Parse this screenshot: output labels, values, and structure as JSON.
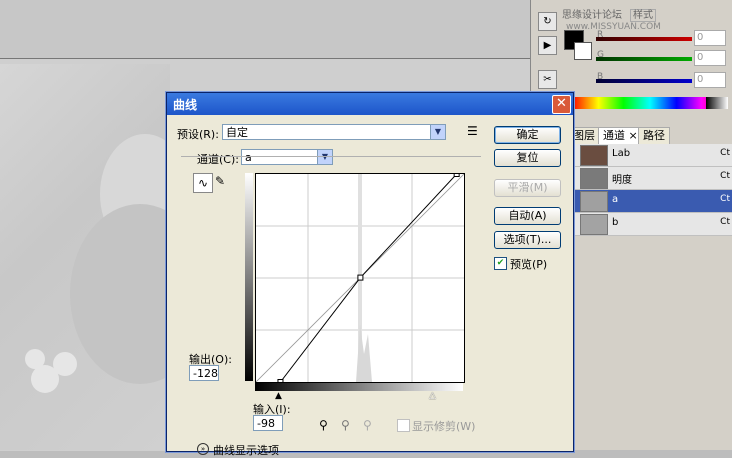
{
  "background": {
    "top_tab_text": "思缘设计论坛",
    "top_tab_text2": "样式",
    "site": "www.MISSYUAN.COM"
  },
  "color_panel": {
    "channels": [
      {
        "label": "R",
        "value": "0",
        "color": "#cc0000"
      },
      {
        "label": "G",
        "value": "0",
        "color": "#00aa00"
      },
      {
        "label": "B",
        "value": "0",
        "color": "#0000cc"
      }
    ]
  },
  "channels_panel": {
    "tabs": [
      "图层",
      "通道",
      "路径"
    ],
    "rows": [
      {
        "name": "Lab",
        "key": "Ct"
      },
      {
        "name": "明度",
        "key": "Ct"
      },
      {
        "name": "a",
        "key": "Ct"
      },
      {
        "name": "b",
        "key": "Ct"
      }
    ]
  },
  "dialog": {
    "title": "曲线",
    "close": "✕",
    "preset_label": "预设(R):",
    "preset_value": "自定",
    "channel_label": "通道(C):",
    "channel_value": "a",
    "buttons": {
      "ok": "确定",
      "reset": "复位",
      "smooth": "平滑(M)",
      "auto": "自动(A)",
      "options": "选项(T)..."
    },
    "preview_label": "预览(P)",
    "output_label": "输出(O):",
    "output_value": "-128",
    "input_label": "输入(I):",
    "input_value": "-98",
    "show_clipping": "显示修剪(W)",
    "curve_options": "曲线显示选项"
  },
  "curve": {
    "points": [
      [
        -98,
        -128
      ],
      [
        0,
        0
      ],
      [
        118,
        127
      ]
    ]
  }
}
